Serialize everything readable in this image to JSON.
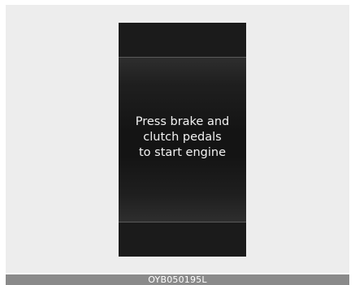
{
  "display": {
    "message_lines": [
      "Press brake and",
      "clutch pedals",
      "to start engine"
    ]
  },
  "caption": {
    "code": "OYB050195L"
  }
}
